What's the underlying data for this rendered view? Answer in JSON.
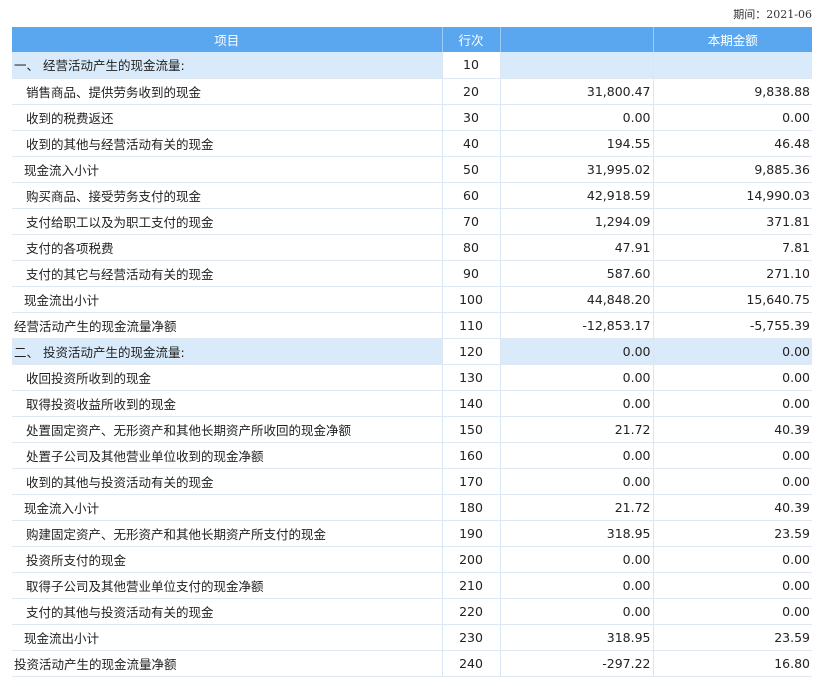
{
  "period_label": "期间：2021-06",
  "table": {
    "headers": {
      "item": "项目",
      "line": "行次",
      "current": "",
      "period": "本期金额"
    },
    "rows": [
      {
        "type": "section",
        "item": "一、 经营活动产生的现金流量:",
        "line": "10",
        "current": "",
        "period": ""
      },
      {
        "type": "detail",
        "item": "销售商品、提供劳务收到的现金",
        "line": "20",
        "current": "31,800.47",
        "period": "9,838.88"
      },
      {
        "type": "detail",
        "item": "收到的税费返还",
        "line": "30",
        "current": "0.00",
        "period": "0.00"
      },
      {
        "type": "detail",
        "item": "收到的其他与经营活动有关的现金",
        "line": "40",
        "current": "194.55",
        "period": "46.48"
      },
      {
        "type": "subtotal",
        "item": "现金流入小计",
        "line": "50",
        "current": "31,995.02",
        "period": "9,885.36"
      },
      {
        "type": "detail",
        "item": "购买商品、接受劳务支付的现金",
        "line": "60",
        "current": "42,918.59",
        "period": "14,990.03"
      },
      {
        "type": "detail",
        "item": "支付给职工以及为职工支付的现金",
        "line": "70",
        "current": "1,294.09",
        "period": "371.81"
      },
      {
        "type": "detail",
        "item": "支付的各项税费",
        "line": "80",
        "current": "47.91",
        "period": "7.81"
      },
      {
        "type": "detail",
        "item": "支付的其它与经营活动有关的现金",
        "line": "90",
        "current": "587.60",
        "period": "271.10"
      },
      {
        "type": "subtotal",
        "item": "现金流出小计",
        "line": "100",
        "current": "44,848.20",
        "period": "15,640.75"
      },
      {
        "type": "total",
        "item": "经营活动产生的现金流量净额",
        "line": "110",
        "current": "-12,853.17",
        "period": "-5,755.39"
      },
      {
        "type": "section",
        "item": "二、 投资活动产生的现金流量:",
        "line": "120",
        "current": "0.00",
        "period": "0.00"
      },
      {
        "type": "detail",
        "item": "收回投资所收到的现金",
        "line": "130",
        "current": "0.00",
        "period": "0.00"
      },
      {
        "type": "detail",
        "item": "取得投资收益所收到的现金",
        "line": "140",
        "current": "0.00",
        "period": "0.00"
      },
      {
        "type": "detail",
        "item": "处置固定资产、无形资产和其他长期资产所收回的现金净额",
        "line": "150",
        "current": "21.72",
        "period": "40.39"
      },
      {
        "type": "detail",
        "item": "处置子公司及其他营业单位收到的现金净额",
        "line": "160",
        "current": "0.00",
        "period": "0.00"
      },
      {
        "type": "detail",
        "item": "收到的其他与投资活动有关的现金",
        "line": "170",
        "current": "0.00",
        "period": "0.00"
      },
      {
        "type": "subtotal",
        "item": "现金流入小计",
        "line": "180",
        "current": "21.72",
        "period": "40.39"
      },
      {
        "type": "detail",
        "item": "购建固定资产、无形资产和其他长期资产所支付的现金",
        "line": "190",
        "current": "318.95",
        "period": "23.59"
      },
      {
        "type": "detail",
        "item": "投资所支付的现金",
        "line": "200",
        "current": "0.00",
        "period": "0.00"
      },
      {
        "type": "detail",
        "item": "取得子公司及其他营业单位支付的现金净额",
        "line": "210",
        "current": "0.00",
        "period": "0.00"
      },
      {
        "type": "detail",
        "item": "支付的其他与投资活动有关的现金",
        "line": "220",
        "current": "0.00",
        "period": "0.00"
      },
      {
        "type": "subtotal",
        "item": "现金流出小计",
        "line": "230",
        "current": "318.95",
        "period": "23.59"
      },
      {
        "type": "total",
        "item": "投资活动产生的现金流量净额",
        "line": "240",
        "current": "-297.22",
        "period": "16.80"
      }
    ]
  }
}
